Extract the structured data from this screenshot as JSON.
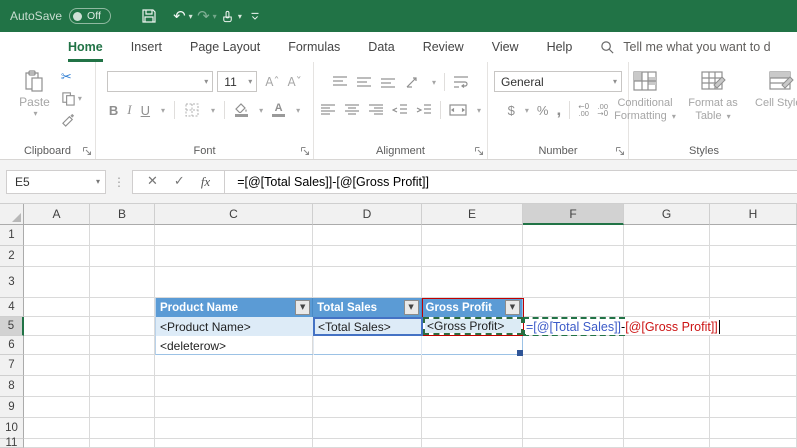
{
  "titlebar": {
    "autosave_label": "AutoSave",
    "autosave_state": "Off"
  },
  "ribbon": {
    "tabs": [
      {
        "label": "Home",
        "active": true
      },
      {
        "label": "Insert"
      },
      {
        "label": "Page Layout"
      },
      {
        "label": "Formulas"
      },
      {
        "label": "Data"
      },
      {
        "label": "Review"
      },
      {
        "label": "View"
      },
      {
        "label": "Help"
      }
    ],
    "search_hint": "Tell me what you want to d",
    "groups": {
      "clipboard": {
        "label": "Clipboard",
        "paste_label": "Paste"
      },
      "font": {
        "label": "Font",
        "font_name": "",
        "font_size": "11"
      },
      "alignment": {
        "label": "Alignment"
      },
      "number": {
        "label": "Number",
        "format": "General"
      },
      "styles": {
        "label": "Styles",
        "buttons": [
          "Conditional Formatting",
          "Format as Table",
          "Cell Styles"
        ]
      }
    }
  },
  "formula_bar": {
    "name_box": "E5",
    "formula": "=[@[Total Sales]]-[@[Gross Profit]]"
  },
  "grid": {
    "columns": [
      "A",
      "B",
      "C",
      "D",
      "E",
      "F",
      "G",
      "H"
    ],
    "rows": [
      "1",
      "2",
      "3",
      "4",
      "5",
      "6",
      "7",
      "8",
      "9",
      "10",
      "11"
    ],
    "selected_column": "F",
    "selected_row": "5"
  },
  "table": {
    "headers": [
      "Product Name",
      "Total Sales",
      "Gross Profit"
    ],
    "data_row": [
      "<Product Name>",
      "<Total Sales>",
      "<Gross Profit>"
    ],
    "delete_row_label": "<deleterow>"
  },
  "cell_edit": {
    "cell": "F5",
    "parts": [
      {
        "text": "=[@[Total Sales]]",
        "color": "#3C5BC8"
      },
      {
        "text": "-",
        "color": "#000000"
      },
      {
        "text": "[@[Gross Profit]]",
        "color": "#CC1414"
      }
    ]
  },
  "icons": {
    "caret": "▾",
    "undo": "↶",
    "redo": "↷",
    "cut": "✂",
    "filter": "▼",
    "check": "✓",
    "cancel": "✕",
    "fx": "fx",
    "grip": "⋮",
    "bold": "B",
    "italic": "I",
    "underline": "U",
    "dollar": "$",
    "percent": "%",
    "comma": ",",
    "font_larger": "Aˆ",
    "font_smaller": "Aˇ",
    "inc_dec_top": "←0",
    "inc_dec_bottom": ".00",
    "dec_dec_top": ".00",
    "dec_dec_bottom": "→0"
  },
  "colors": {
    "excel_green": "#217346",
    "table_header": "#5B9BD5",
    "banded_row": "#DDEBF7",
    "ref_blue_border": "#4472C4",
    "ref_red_border": "#C00000",
    "selected_header": "#D2D2D2"
  }
}
